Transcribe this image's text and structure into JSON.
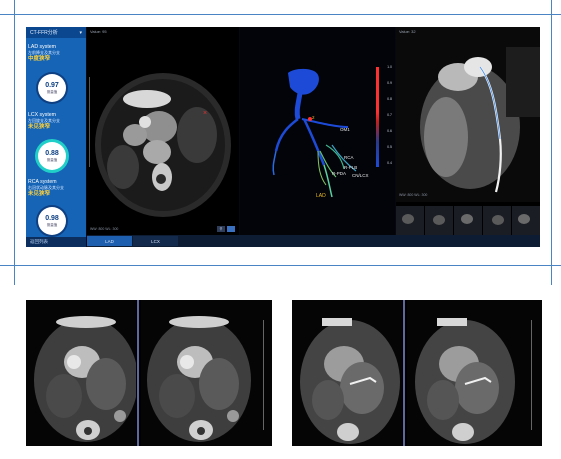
{
  "app": {
    "sidebar": {
      "header": "CT-FFR分析",
      "header_icon": "chevron-down-icon",
      "sections": [
        {
          "title": "LAD system",
          "subtitle": "左前降支及其分支",
          "status": "中度狭窄",
          "status_color": "#ffd23c",
          "value": "0.97",
          "value_label": "测量值",
          "ring_color": "#1564b6"
        },
        {
          "title": "LCX system",
          "subtitle": "左回旋支及其分支",
          "status": "未见狭窄",
          "status_color": "#ffd23c",
          "value": "0.88",
          "value_label": "测量值",
          "ring_color": "#20d0c8"
        },
        {
          "title": "RCA system",
          "subtitle": "右冠状动脉及其分支",
          "status": "未见狭窄",
          "status_color": "#ffd23c",
          "value": "0.98",
          "value_label": "测量值",
          "ring_color": "#1564b6"
        }
      ],
      "footer": "返回列表"
    },
    "views": {
      "left_label": "Value: 95",
      "right_label": "Value: 32",
      "corner_left": "WW: 800   WL: 300",
      "corner_right": "WW: 800   WL: 300"
    },
    "vessel_labels": [
      "OM1",
      "RCA",
      "R-PDA",
      "R-PLB",
      "CN/LCX",
      "LAD",
      "2"
    ],
    "scale_labels": [
      "1.0",
      "0.9",
      "0.8",
      "0.7",
      "0.6",
      "0.5",
      "0.4"
    ],
    "tabs": [
      "LAD",
      "LCX"
    ],
    "colors": {
      "accent": "#1564b6",
      "ffr_high": "#1d4bd8",
      "ffr_low": "#ff3030",
      "lad_label": "#f0c020"
    }
  }
}
